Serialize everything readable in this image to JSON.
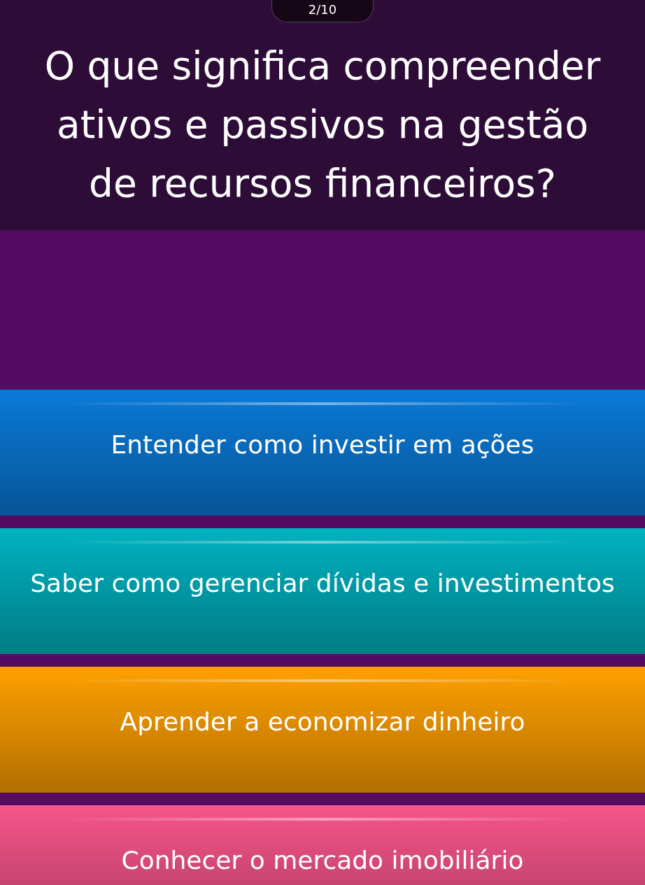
{
  "counter": "2/10",
  "question": "O que significa compreender ativos e passivos na gestão de recursos financeiros?",
  "answers": [
    {
      "label": "Entender como investir em ações",
      "color": "#0a7ad8"
    },
    {
      "label": "Saber como gerenciar dívidas e investimentos",
      "color": "#00b2c0"
    },
    {
      "label": "Aprender a economizar dinheiro",
      "color": "#ffa000"
    },
    {
      "label": "Conhecer o mercado imobiliário",
      "color": "#f7558a"
    }
  ]
}
